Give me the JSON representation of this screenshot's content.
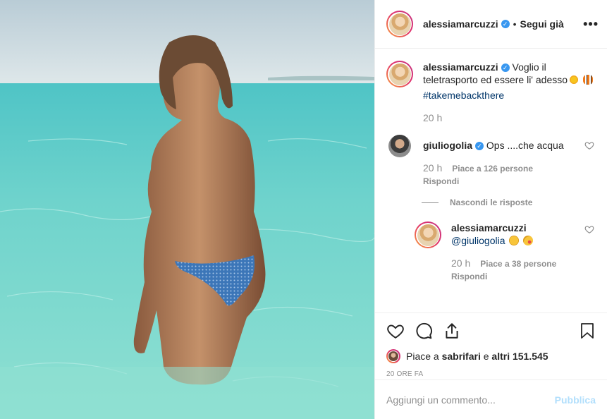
{
  "post": {
    "author": "alessiamarcuzzi",
    "follow_status": "Segui già",
    "more": "•••",
    "caption_text": "Voglio il teletrasporto ed essere li' adesso",
    "caption_hashtag": "#takemebackthere",
    "caption_time": "20 h"
  },
  "comments": [
    {
      "user": "giuliogolia",
      "text": "Ops ....che acqua",
      "time": "20 h",
      "likes": "Piace a 126 persone",
      "reply_label": "Rispondi"
    }
  ],
  "hide_replies": "Nascondi le risposte",
  "replies": [
    {
      "user": "alessiamarcuzzi",
      "mention": "@giuliogolia",
      "time": "20 h",
      "likes": "Piace a 38 persone",
      "reply_label": "Rispondi"
    }
  ],
  "likes_summary": {
    "prefix": "Piace a ",
    "first_liker": "sabrifari",
    "middle": " e ",
    "others": "altri 151.545"
  },
  "timestamp": "20 ORE FA",
  "comment_box": {
    "placeholder": "Aggiungi un commento...",
    "publish_label": "Pubblica"
  },
  "colors": {
    "link": "#003569",
    "muted": "#8e8e8e",
    "verified": "#3897f0",
    "publish_disabled": "#b2dffc"
  }
}
